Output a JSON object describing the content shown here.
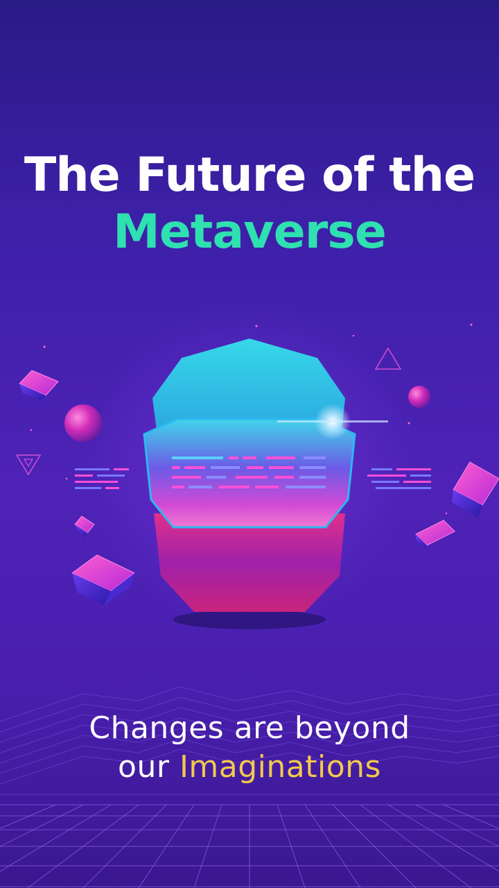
{
  "headline": {
    "line1": "The Future of the",
    "line2": "Metaverse"
  },
  "tagline": {
    "line1": "Changes are beyond",
    "line2_prefix": "our ",
    "line2_accent": "Imaginations"
  },
  "colors": {
    "background_top": "#2a1a86",
    "background_mid": "#4e22b6",
    "headline_white": "#ffffff",
    "headline_accent": "#2fe0b0",
    "tagline_accent": "#f2c94c",
    "helmet_cyan": "#3cd7e6",
    "helmet_magenta": "#e0308c"
  },
  "icons": [
    "vr-helmet-icon",
    "cube-icon",
    "sphere-icon",
    "triangle-icon",
    "grid-floor-icon"
  ]
}
